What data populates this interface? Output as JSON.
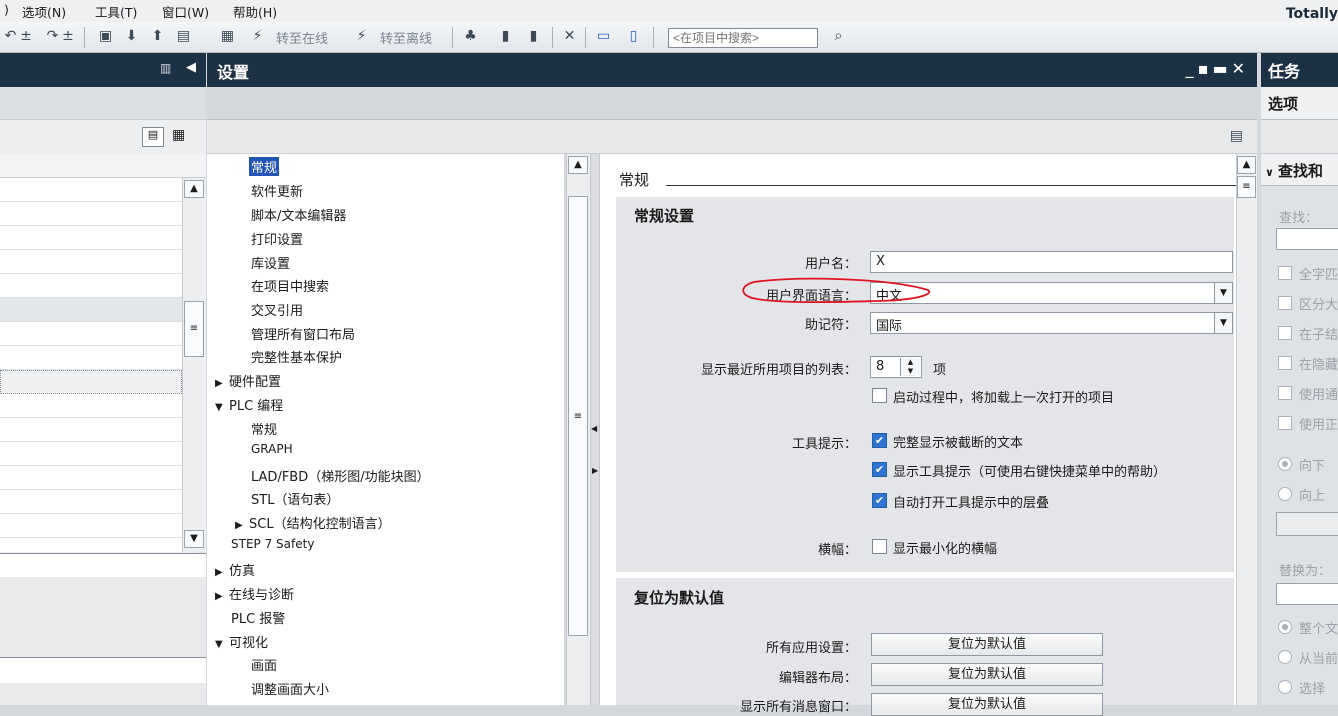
{
  "menubar": {
    "items": [
      "选项(N)",
      "工具(T)",
      "窗口(W)",
      "帮助(H)"
    ],
    "brand": "Totally"
  },
  "toolbar": {
    "go_online": "转至在线",
    "go_offline": "转至离线",
    "search_placeholder": "<在项目中搜索>"
  },
  "settings": {
    "title": "设置",
    "nav": [
      {
        "label": "常规",
        "selected": true
      },
      {
        "label": "软件更新"
      },
      {
        "label": "脚本/文本编辑器"
      },
      {
        "label": "打印设置"
      },
      {
        "label": "库设置"
      },
      {
        "label": "在项目中搜索"
      },
      {
        "label": "交叉引用"
      },
      {
        "label": "管理所有窗口布局"
      },
      {
        "label": "完整性基本保护"
      },
      {
        "label": "硬件配置"
      },
      {
        "label": "PLC 编程"
      },
      {
        "label": "常规"
      },
      {
        "label": "GRAPH"
      },
      {
        "label": "LAD/FBD（梯形图/功能块图）"
      },
      {
        "label": "STL（语句表）"
      },
      {
        "label": "SCL（结构化控制语言）"
      },
      {
        "label": "STEP 7 Safety"
      },
      {
        "label": "仿真"
      },
      {
        "label": "在线与诊断"
      },
      {
        "label": "PLC 报警"
      },
      {
        "label": "可视化"
      },
      {
        "label": "画面"
      },
      {
        "label": "调整画面大小"
      }
    ],
    "section_title": "常规",
    "general": {
      "group_title": "常规设置",
      "username_label": "用户名：",
      "username_value": "X",
      "ui_lang_label": "用户界面语言：",
      "ui_lang_value": "中文",
      "mnemonic_label": "助记符：",
      "mnemonic_value": "国际",
      "recent_label": "显示最近所用项目的列表：",
      "recent_value": "8",
      "recent_unit": "项",
      "load_last_label": "启动过程中，将加载上一次打开的项目",
      "tooltip_label": "工具提示：",
      "tooltip_1": "完整显示被截断的文本",
      "tooltip_2": "显示工具提示（可使用右键快捷菜单中的帮助）",
      "tooltip_3": "自动打开工具提示中的层叠",
      "banner_label": "横幅：",
      "banner_1": "显示最小化的横幅"
    },
    "reset": {
      "group_title": "复位为默认值",
      "all_app_label": "所有应用设置：",
      "editor_layout_label": "编辑器布局：",
      "msg_windows_label": "显示所有消息窗口：",
      "button_label": "复位为默认值"
    }
  },
  "tasks": {
    "title": "任务",
    "options": "选项",
    "find_replace": "查找和",
    "find_label": "查找：",
    "checks": [
      "全字匹",
      "区分大",
      "在子结",
      "在隐藏",
      "使用通",
      "使用正"
    ],
    "dir_down": "向下",
    "dir_up": "向上",
    "replace_label": "替换为：",
    "scope": [
      "整个文",
      "从当前",
      "选择"
    ]
  },
  "colors": {
    "header": "#1d3144",
    "selection": "#2456b7",
    "annotation": "#e0141e"
  }
}
